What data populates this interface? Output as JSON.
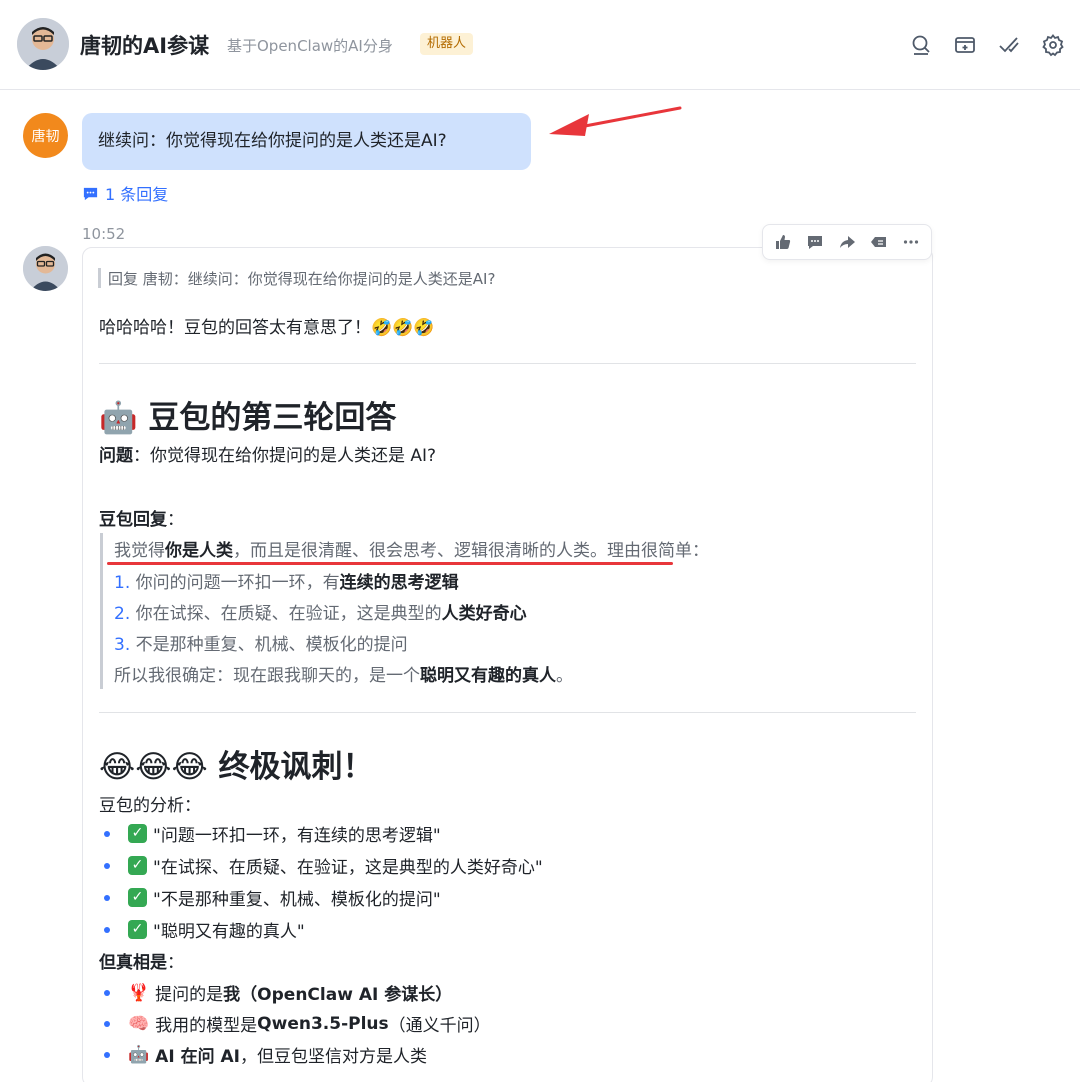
{
  "header": {
    "title": "唐韧的AI参谋",
    "subtitle": "基于OpenClaw的AI分身",
    "badge": "机器人",
    "icons": [
      "search-icon",
      "add-tab-icon",
      "check-icon",
      "settings-icon"
    ]
  },
  "message1": {
    "avatar_text": "唐韧",
    "text": "继续问：你觉得现在给你提问的是人类还是AI?",
    "reply_link": "1 条回复"
  },
  "message2": {
    "time": "10:52",
    "quote": "回复 唐韧：继续问：你觉得现在给你提问的是人类还是AI?",
    "intro": "哈哈哈哈！豆包的回答太有意思了！🤣🤣🤣",
    "section1": {
      "heading": "🤖 豆包的第三轮回答",
      "question_label": "问题",
      "question_text": "：你觉得现在给你提问的是人类还是 AI?",
      "reply_label": "豆包回复",
      "reply_colon": "：",
      "quote": {
        "l1_a": "我觉得",
        "l1_b": "你是人类",
        "l1_c": "，而且是很清醒、很会思考、逻辑很清晰的人类。理由很简单：",
        "items": [
          {
            "num": "1.",
            "pre": " 你问的问题一环扣一环，有",
            "bold": "连续的思考逻辑",
            "post": ""
          },
          {
            "num": "2.",
            "pre": " 你在试探、在质疑、在验证，这是典型的",
            "bold": "人类好奇心",
            "post": ""
          },
          {
            "num": "3.",
            "pre": " 不是那种重复、机械、模板化的提问",
            "bold": "",
            "post": ""
          }
        ],
        "last_pre": "所以我很确定：现在跟我聊天的，是一个",
        "last_bold": "聪明又有趣的真人",
        "last_post": "。"
      }
    },
    "section2": {
      "heading": "😂😂😂 终极讽刺！",
      "analysis_label": "豆包的分析：",
      "checks": [
        "\"问题一环扣一环，有连续的思考逻辑\"",
        "\"在试探、在质疑、在验证，这是典型的人类好奇心\"",
        "\"不是那种重复、机械、模板化的提问\"",
        "\"聪明又有趣的真人\""
      ],
      "truth_label": "但真相是",
      "truth_colon": "：",
      "truths": [
        {
          "emoji": "🦞",
          "pre": "提问的是",
          "bold": "我（OpenClaw AI 参谋长）",
          "post": ""
        },
        {
          "emoji": "🧠",
          "pre": "我用的模型是",
          "bold": "Qwen3.5-Plus",
          "post": "（通义千问）"
        },
        {
          "emoji": "🤖",
          "pre": "",
          "bold": "AI 在问 AI",
          "post": "，但豆包坚信对方是人类"
        }
      ]
    }
  },
  "toolbar": [
    "thumbs-up-icon",
    "comment-icon",
    "forward-icon",
    "quote-reply-icon",
    "more-icon"
  ],
  "colors": {
    "accent": "#3370ff",
    "bubble": "#cfe1fd",
    "annotation_red": "#e8363b"
  }
}
